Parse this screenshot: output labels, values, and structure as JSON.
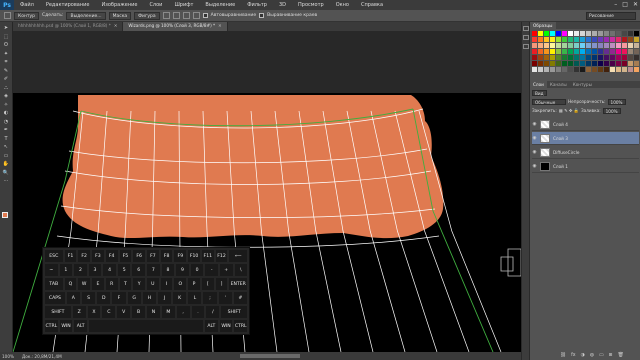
{
  "menu": {
    "logo": "Ps",
    "items": [
      "Файл",
      "Редактирование",
      "Изображение",
      "Слои",
      "Шрифт",
      "Выделение",
      "Фильтр",
      "3D",
      "Просмотр",
      "Окно",
      "Справка"
    ],
    "window_controls": [
      "–",
      "□",
      "✕"
    ]
  },
  "options_bar": {
    "style_select": "Контур",
    "make_label": "Сделать:",
    "selection_button": "Выделение...",
    "mask_button": "Маска",
    "shape_button": "Фигура",
    "autoalign_label": "Автовыравнивание",
    "edges_label": "Выравнивание краев",
    "workspace": "Рисование"
  },
  "doc_tabs": [
    {
      "title": "hhhhhhhhhh.psd @ 100% (Слой 1, RGB/8) *",
      "active": false
    },
    {
      "title": "Wizards.png @ 100% (Слой 3, RGB/8#) *",
      "active": true
    }
  ],
  "tools": [
    "➤",
    "⬚",
    "ʘ",
    "✦",
    "⌗",
    "✎",
    "✐",
    "⛬",
    "◈",
    "✧",
    "◐",
    "◔",
    "✒",
    "T",
    "↖",
    "▭",
    "✋",
    "🔍",
    "⋯"
  ],
  "keyboard": {
    "rows": [
      [
        "ESC",
        "F1",
        "F2",
        "F3",
        "F4",
        "F5",
        "F6",
        "F7",
        "F8",
        "F9",
        "F10",
        "F11",
        "F12",
        "⟵"
      ],
      [
        "~",
        "1",
        "2",
        "3",
        "4",
        "5",
        "6",
        "7",
        "8",
        "9",
        "0",
        "-",
        "+",
        "\\"
      ],
      [
        "TAB",
        "Q",
        "W",
        "E",
        "R",
        "T",
        "Y",
        "U",
        "I",
        "O",
        "P",
        "[",
        "]",
        "ENTER"
      ],
      [
        "CAPS",
        "A",
        "S",
        "D",
        "F",
        "G",
        "H",
        "J",
        "K",
        "L",
        ";",
        "'",
        "#"
      ],
      [
        "SHIFT",
        "Z",
        "X",
        "C",
        "V",
        "B",
        "N",
        "M",
        ",",
        ".",
        "/",
        "SHIFT"
      ],
      [
        "CTRL",
        "WIN",
        "ALT",
        "",
        "ALT",
        "WIN",
        "CTRL"
      ]
    ]
  },
  "status": {
    "zoom": "100%",
    "doc_info": "Док.: 20,8M/21,4M"
  },
  "panels": {
    "top_tabs": [
      "Образцы"
    ],
    "layers_tabs": [
      "Слои",
      "Каналы",
      "Контуры"
    ],
    "kind_select": "Вид",
    "blend_mode": "Обычные",
    "opacity_label": "Непрозрачность:",
    "opacity_value": "100%",
    "lock_label": "Закрепить:",
    "fill_label": "Заливка:",
    "fill_value": "100%",
    "layers": [
      {
        "name": "Слой 4",
        "selected": false,
        "thumb": "check"
      },
      {
        "name": "Слой 3",
        "selected": true,
        "thumb": "check"
      },
      {
        "name": "DiffuseCircle",
        "selected": false,
        "thumb": "check"
      },
      {
        "name": "Слой 1",
        "selected": false,
        "thumb": "black"
      }
    ],
    "footer_icons": [
      "⛓",
      "fx",
      "◑",
      "◍",
      "▭",
      "⊞",
      "🗑"
    ]
  },
  "colors": {
    "foreground": "#e07a50",
    "shape_fill": "#e07a50",
    "mesh_line": "#ffffff",
    "guide_line": "#3fae3f",
    "selected_layer": "#6a7fa3",
    "swatches": [
      "#ff0000",
      "#ffff00",
      "#00ff00",
      "#00ffff",
      "#0000ff",
      "#ff00ff",
      "#ffffff",
      "#ebebeb",
      "#d6d6d6",
      "#c2c2c2",
      "#adadad",
      "#999999",
      "#858585",
      "#707070",
      "#5c5c5c",
      "#474747",
      "#333333",
      "#000000",
      "#ff3a2e",
      "#ff7a1c",
      "#ffc31c",
      "#ffee1c",
      "#9be32c",
      "#3fc93a",
      "#22b573",
      "#1ab5a8",
      "#1a9fd6",
      "#2a6fd1",
      "#3a4bb8",
      "#6a3ab8",
      "#9a2ab0",
      "#c82ea0",
      "#e02a6a",
      "#b0171d",
      "#8a4a1a",
      "#c7a52a",
      "#f7977a",
      "#f9ad81",
      "#fdc68a",
      "#fff79a",
      "#c4df9b",
      "#a3d39c",
      "#82ca9d",
      "#7bcdc8",
      "#6ecff6",
      "#7ea7d8",
      "#8493ca",
      "#8882be",
      "#a187be",
      "#bc8dbf",
      "#f49ac2",
      "#f6989d",
      "#e8d0b0",
      "#c7b299",
      "#ed1c24",
      "#f26522",
      "#f7941d",
      "#fff200",
      "#8dc63f",
      "#39b54a",
      "#00a651",
      "#00a99d",
      "#00aeef",
      "#0072bc",
      "#0054a6",
      "#2e3192",
      "#662d91",
      "#92278f",
      "#ec008c",
      "#ed145b",
      "#998675",
      "#736357",
      "#9e0b0f",
      "#a0410d",
      "#a3620a",
      "#aba000",
      "#598527",
      "#197b30",
      "#007236",
      "#00746b",
      "#0076a3",
      "#004a80",
      "#003471",
      "#1b1464",
      "#440e62",
      "#630460",
      "#9e005d",
      "#9e0039",
      "#534741",
      "#362f2d",
      "#790000",
      "#7b2e00",
      "#7d4900",
      "#827b00",
      "#406618",
      "#005e20",
      "#005826",
      "#005952",
      "#005b7f",
      "#003663",
      "#002157",
      "#0d004c",
      "#32004b",
      "#4b0049",
      "#7b0046",
      "#7a0026",
      "#c69c6d",
      "#a67c52",
      "#e6e6e6",
      "#cccccc",
      "#b3b3b3",
      "#999999",
      "#808080",
      "#666666",
      "#4d4d4d",
      "#333333",
      "#1a1a1a",
      "#8c6239",
      "#754c24",
      "#603913",
      "#42210b",
      "#f5deb3",
      "#deb887",
      "#d2b48c",
      "#bc8f8f",
      "#f4a460"
    ]
  }
}
